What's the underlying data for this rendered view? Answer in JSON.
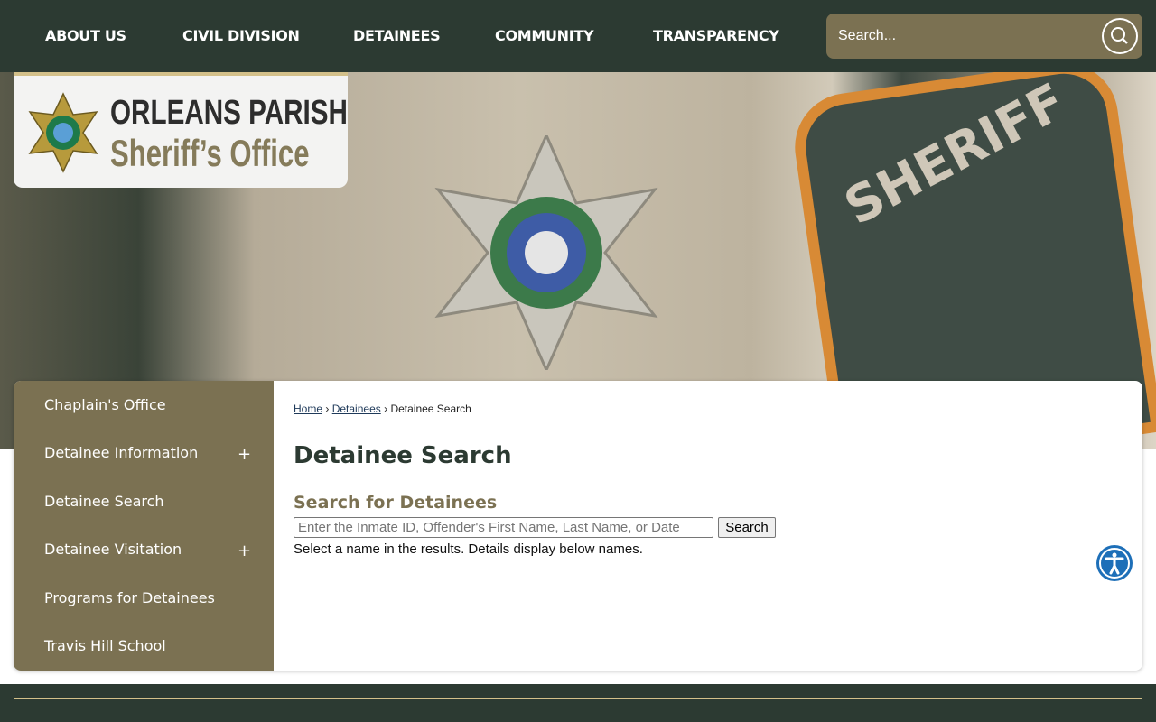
{
  "nav": {
    "items": [
      "ABOUT US",
      "CIVIL DIVISION",
      "DETAINEES",
      "COMMUNITY",
      "TRANSPARENCY"
    ],
    "search_placeholder": "Search..."
  },
  "logo": {
    "line1": "ORLEANS PARISH",
    "line2": "Sheriff’s Office"
  },
  "hero": {
    "patch_text": "SHERIFF"
  },
  "sidebar": {
    "items": [
      {
        "label": "Chaplain's Office",
        "expand": false
      },
      {
        "label": "Detainee Information",
        "expand": true
      },
      {
        "label": "Detainee Search",
        "expand": false
      },
      {
        "label": "Detainee Visitation",
        "expand": true
      },
      {
        "label": "Programs for Detainees",
        "expand": false
      },
      {
        "label": "Travis Hill School",
        "expand": false
      }
    ],
    "expand_symbol": "+"
  },
  "breadcrumb": {
    "home": "Home",
    "detainees": " Detainees",
    "current": "Detainee Search",
    "sep": "›"
  },
  "main": {
    "title": "Detainee Search",
    "subtitle": "Search for Detainees",
    "input_placeholder": "Enter the Inmate ID, Offender's First Name, Last Name, or Date",
    "search_button": "Search",
    "hint": "Select a name in the results. Details display below names."
  },
  "colors": {
    "nav": "#2c3a32",
    "accent": "#7b7152",
    "gold": "#d3c08a",
    "a11y": "#1d6fb8"
  }
}
